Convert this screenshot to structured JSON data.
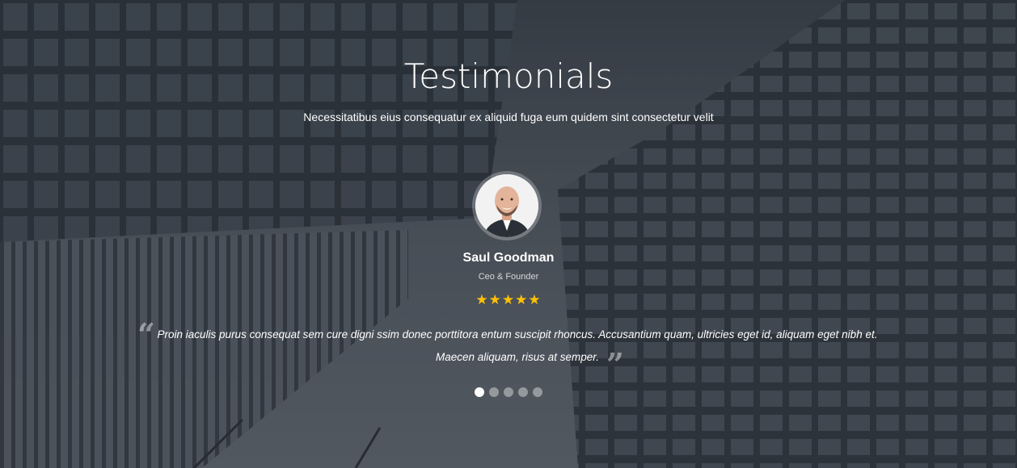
{
  "section": {
    "title": "Testimonials",
    "subtitle": "Necessitatibus eius consequatur ex aliquid fuga eum quidem sint consectetur velit"
  },
  "testimonial": {
    "name": "Saul Goodman",
    "role": "Ceo & Founder",
    "rating": 5,
    "stars": "★★★★★",
    "quote": "Proin iaculis purus consequat sem cure digni ssim donec porttitora entum suscipit rhoncus. Accusantium quam, ultricies eget id, aliquam eget nibh et. Maecen aliquam, risus at semper."
  },
  "carousel": {
    "slide_count": 5,
    "active_index": 0
  },
  "colors": {
    "star": "#ffc107",
    "text": "#ffffff",
    "dot_active": "#ffffff",
    "dot_inactive": "rgba(255,255,255,0.4)"
  },
  "icons": {
    "quote_open": "quote-left-icon",
    "quote_close": "quote-right-icon"
  }
}
